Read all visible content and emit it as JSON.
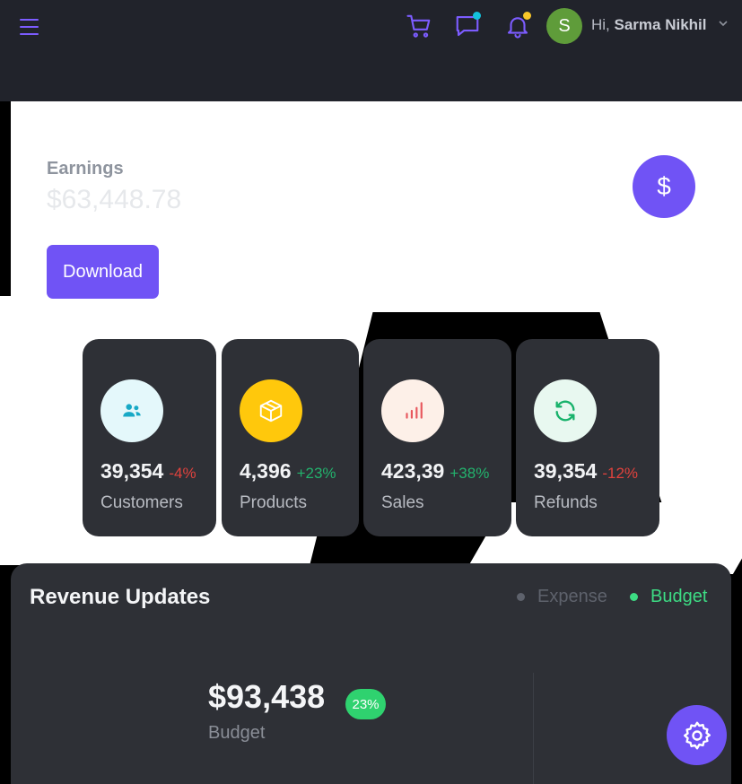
{
  "header": {
    "greeting": "Hi,",
    "user_name": "Sarma Nikhil",
    "avatar_letter": "S"
  },
  "earnings": {
    "label": "Earnings",
    "value": "$63,448.78",
    "download_label": "Download",
    "currency_symbol": "$"
  },
  "stats": [
    {
      "value": "39,354",
      "change": "-4%",
      "label": "Customers",
      "icon": "users-icon",
      "trend": "negative"
    },
    {
      "value": "4,396",
      "change": "+23%",
      "label": "Products",
      "icon": "box-icon",
      "trend": "positive"
    },
    {
      "value": "423,39",
      "change": "+38%",
      "label": "Sales",
      "icon": "bar-chart-icon",
      "trend": "positive"
    },
    {
      "value": "39,354",
      "change": "-12%",
      "label": "Refunds",
      "icon": "refresh-icon",
      "trend": "negative"
    }
  ],
  "revenue": {
    "title": "Revenue Updates",
    "legend": {
      "expense": "Expense",
      "budget": "Budget"
    },
    "amount": "$93,438",
    "badge": "23%",
    "subtitle": "Budget"
  },
  "colors": {
    "accent": "#7053f5",
    "positive": "#23b26d",
    "negative": "#e0423d",
    "budget": "#3ddc84"
  }
}
